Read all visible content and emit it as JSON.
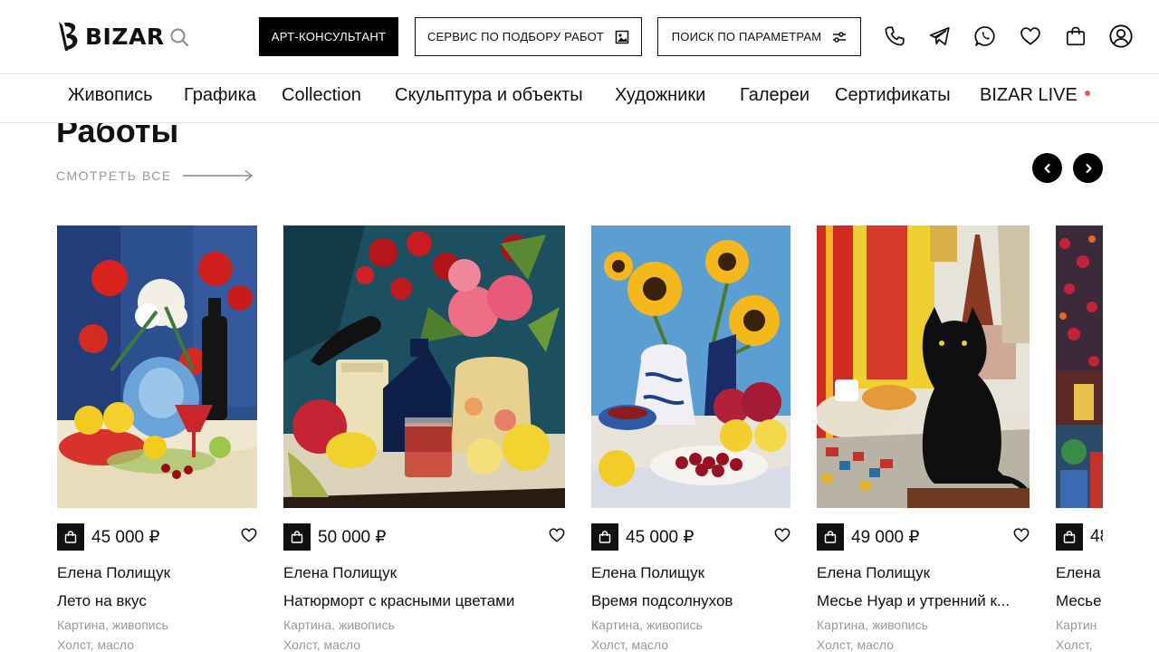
{
  "brand": {
    "name": "BIZAR"
  },
  "header": {
    "art_consultant_label": "АРТ-КОНСУЛЬТАНТ",
    "service_label": "СЕРВИС ПО ПОДБОРУ РАБОТ",
    "params_label": "ПОИСК ПО ПАРАМЕТРАМ",
    "icons": [
      "search-icon",
      "phone-icon",
      "telegram-icon",
      "whatsapp-icon",
      "heart-icon",
      "bag-icon",
      "user-icon"
    ]
  },
  "nav": {
    "items": [
      "Живопись",
      "Графика",
      "Collection",
      "Скульптура и объекты",
      "Художники",
      "Галереи",
      "Сертификаты",
      "BIZAR LIVE"
    ]
  },
  "section": {
    "title": "Работы",
    "see_all": "СМОТРЕТЬ ВСЕ"
  },
  "cards": [
    {
      "price": "45 000 ₽",
      "artist": "Елена Полищук",
      "title": "Лето на вкус",
      "meta1": "Картина, живопись",
      "meta2": "Холст, масло"
    },
    {
      "price": "50 000 ₽",
      "artist": "Елена Полищук",
      "title": "Натюрморт с красными цветами",
      "meta1": "Картина, живопись",
      "meta2": "Холст, масло"
    },
    {
      "price": "45 000 ₽",
      "artist": "Елена Полищук",
      "title": "Время подсолнухов",
      "meta1": "Картина, живопись",
      "meta2": "Холст, масло"
    },
    {
      "price": "49 000 ₽",
      "artist": "Елена Полищук",
      "title": "Месье Нуар и утренний к...",
      "meta1": "Картина, живопись",
      "meta2": "Холст, масло"
    },
    {
      "price": "48",
      "artist": "Елена",
      "title": "Месье",
      "meta1": "Картин",
      "meta2": "Холст,"
    }
  ],
  "colors": {
    "accent": "#000000",
    "live_dot": "#e06060",
    "muted_text": "#9a9a9a"
  }
}
